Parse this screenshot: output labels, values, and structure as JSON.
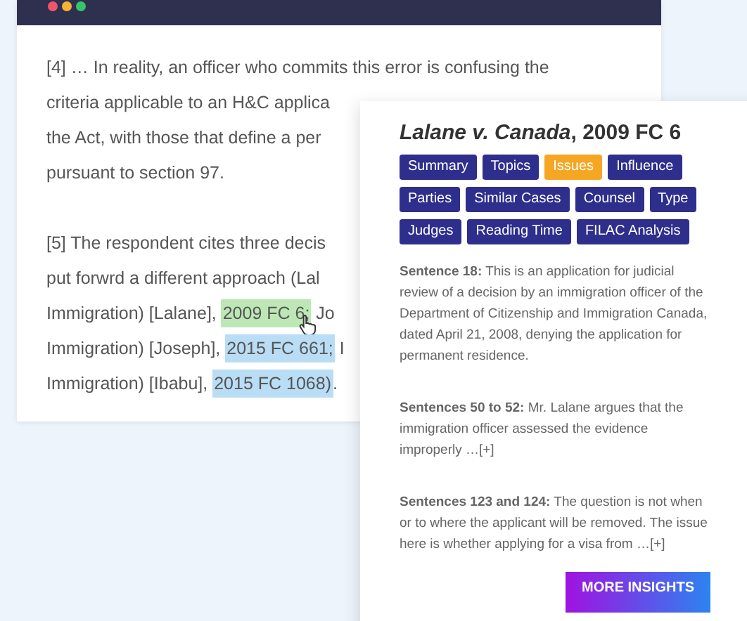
{
  "window": {
    "controls": [
      {
        "color": "#f0556a"
      },
      {
        "color": "#f5b331"
      },
      {
        "color": "#36c46b"
      }
    ]
  },
  "document": {
    "paragraphs": [
      {
        "lines": [
          [
            {
              "text": "[4]  … In reality, an officer who commits this error is confusing the"
            }
          ],
          [
            {
              "text": "criteria applicable to an H&C applica"
            }
          ],
          [
            {
              "text": "the Act, with those that define a per"
            }
          ],
          [
            {
              "text": "pursuant to section 97."
            }
          ]
        ]
      },
      {
        "lines": [
          [
            {
              "text": "[5]  The respondent cites three decis"
            }
          ],
          [
            {
              "text": "put forwrd a different approach (Lal"
            }
          ],
          [
            {
              "text": "Immigration) [Lalane], "
            },
            {
              "text": "2009 FC 6;",
              "color": "#bde8b6",
              "cursor": true
            },
            {
              "text": " Jo"
            }
          ],
          [
            {
              "text": "Immigration) [Joseph], "
            },
            {
              "text": "2015 FC 661;",
              "color": "#b9ddf5"
            },
            {
              "text": " I"
            }
          ],
          [
            {
              "text": "Immigration) [Ibabu], "
            },
            {
              "text": "2015 FC 1068)",
              "color": "#b9ddf5"
            },
            {
              "text": "."
            }
          ]
        ]
      }
    ]
  },
  "popup": {
    "title": "*Lalane v. Canada*, 2009 FC 6",
    "tabs": [
      {
        "label": "Summary",
        "selected": false
      },
      {
        "label": "Topics",
        "selected": false
      },
      {
        "label": "Issues",
        "selected": true
      },
      {
        "label": "Influence",
        "selected": false
      },
      {
        "label": "Parties",
        "selected": false
      },
      {
        "label": "Similar Cases",
        "selected": false
      },
      {
        "label": "Counsel",
        "selected": false
      },
      {
        "label": "Type",
        "selected": false
      },
      {
        "label": "Judges",
        "selected": false
      },
      {
        "label": "Reading Time",
        "selected": false
      },
      {
        "label": "FILAC Analysis",
        "selected": false
      }
    ],
    "sentences": [
      {
        "text": "**Sentence 18:** This is an application for judicial review of a decision by an immigration officer of the Department of Citizenship and Immigration Canada, dated April 21, 2008, denying the application for permanent residence."
      },
      {
        "text": "**Sentences 50 to 52:** Mr. Lalane argues that the immigration officer assessed the evidence improperly …[+]"
      },
      {
        "text": "**Sentences 123 and 124:** The question is not when or to where the applicant will be removed. The issue here is whether applying for a visa from …[+]"
      }
    ],
    "button": "MORE INSIGHTS"
  }
}
